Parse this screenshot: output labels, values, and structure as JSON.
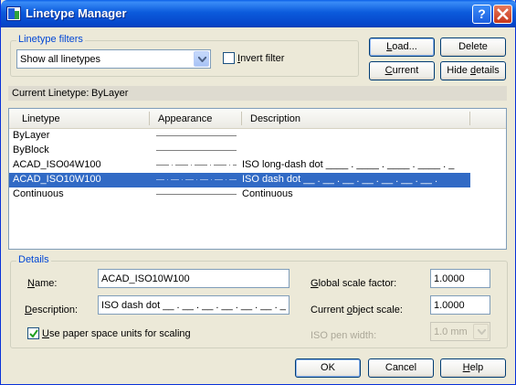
{
  "window": {
    "title": "Linetype Manager"
  },
  "filters": {
    "group_label": "Linetype filters",
    "selected": "Show all linetypes",
    "invert_label_pre": "",
    "invert_label_u": "I",
    "invert_label_post": "nvert filter",
    "invert_checked": false
  },
  "buttons": {
    "load_u": "L",
    "load_rest": "oad...",
    "delete": "Delete",
    "current_u": "C",
    "current_rest": "urrent",
    "hide_pre": "Hide ",
    "hide_u": "d",
    "hide_post": "etails",
    "ok": "OK",
    "cancel": "Cancel",
    "help_u": "H",
    "help_rest": "elp"
  },
  "current_linetype": {
    "label": "Current Linetype:",
    "value": "ByLayer"
  },
  "list": {
    "columns": [
      "Linetype",
      "Appearance",
      "Description"
    ],
    "rows": [
      {
        "name": "ByLayer",
        "description": "",
        "selected": false
      },
      {
        "name": "ByBlock",
        "description": "",
        "selected": false
      },
      {
        "name": "ACAD_ISO04W100",
        "description": "ISO long-dash dot ____ . ____ . ____ . ____ . _",
        "selected": false
      },
      {
        "name": "ACAD_ISO10W100",
        "description": "ISO dash dot __ . __ . __ . __ . __ . __ . __ .",
        "selected": true
      },
      {
        "name": "Continuous",
        "description": "Continuous",
        "selected": false
      }
    ]
  },
  "details": {
    "group_label": "Details",
    "name_label_u": "N",
    "name_label_rest": "ame:",
    "name_value": "ACAD_ISO10W100",
    "desc_label_u": "D",
    "desc_label_pre": "",
    "desc_label_rest": "escription:",
    "desc_value": "ISO dash dot __ . __ . __ . __ . __ . __ . __ .",
    "paper_space_pre": "",
    "paper_space_u": "U",
    "paper_space_post": "se paper space units for scaling",
    "paper_space_checked": true,
    "global_scale_label_pre": "",
    "global_scale_label_u": "G",
    "global_scale_label_post": "lobal scale factor:",
    "global_scale_value": "1.0000",
    "object_scale_label_pre": "Current ",
    "object_scale_label_u": "o",
    "object_scale_label_post": "bject scale:",
    "object_scale_value": "1.0000",
    "pen_width_label": "ISO pen width:",
    "pen_width_value": "1.0 mm"
  },
  "colors": {
    "accent": "#316ac5",
    "group_label": "#0046d5",
    "title_bar": "#0b5bdc"
  }
}
